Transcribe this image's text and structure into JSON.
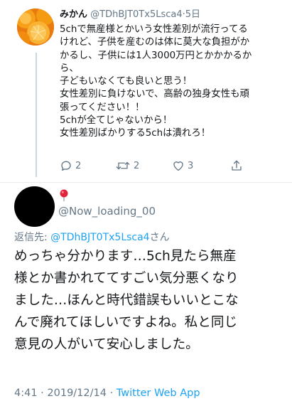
{
  "tweet1": {
    "display_name": "みかん",
    "handle": "@TDhBJT0Tx5Lsca4",
    "separator": "·",
    "time": "5日",
    "body_lines": [
      "5chで無産様とかいう女性差別が流行ってる",
      "けれど、子供を産むのは体に莫大な負担がか",
      "かるし、子供には1人3000万円とかかかるか",
      "ら、",
      "子どもいなくても良いと思う！",
      "女性差別に負けないで、高齢の独身女性も頑",
      "張ってください！！",
      "5chが全てじゃないから！",
      "女性差別ばかりする5chは潰れろ！"
    ],
    "actions": {
      "reply_count": "2",
      "retweet_count": "2",
      "like_count": "3"
    }
  },
  "tweet2": {
    "handle": "@Now_loading_00",
    "replying_prefix": "返信先: ",
    "replying_handle": "@TDhBJT0Tx5Lsca4",
    "replying_suffix": "さん",
    "body_lines": [
      "めっちゃ分かります…5ch見たら無産",
      "様とか書かれててすごい気分悪くなり",
      "ました…ほんと時代錯誤もいいとこな",
      "んで廃れてほしいですよね。私と同じ",
      "意見の人がいて安心しました。"
    ],
    "footer_time": "4:41 · 2019/12/14 · ",
    "footer_app": "Twitter Web App"
  },
  "colors": {
    "text": "#14171a",
    "secondary": "#657786",
    "link": "#1da1f2",
    "divider": "#e6ecf0",
    "thread_line": "#ccd6dd"
  },
  "icons": [
    "reply-icon",
    "retweet-icon",
    "like-icon",
    "share-icon",
    "pushpin-emoji-icon"
  ]
}
